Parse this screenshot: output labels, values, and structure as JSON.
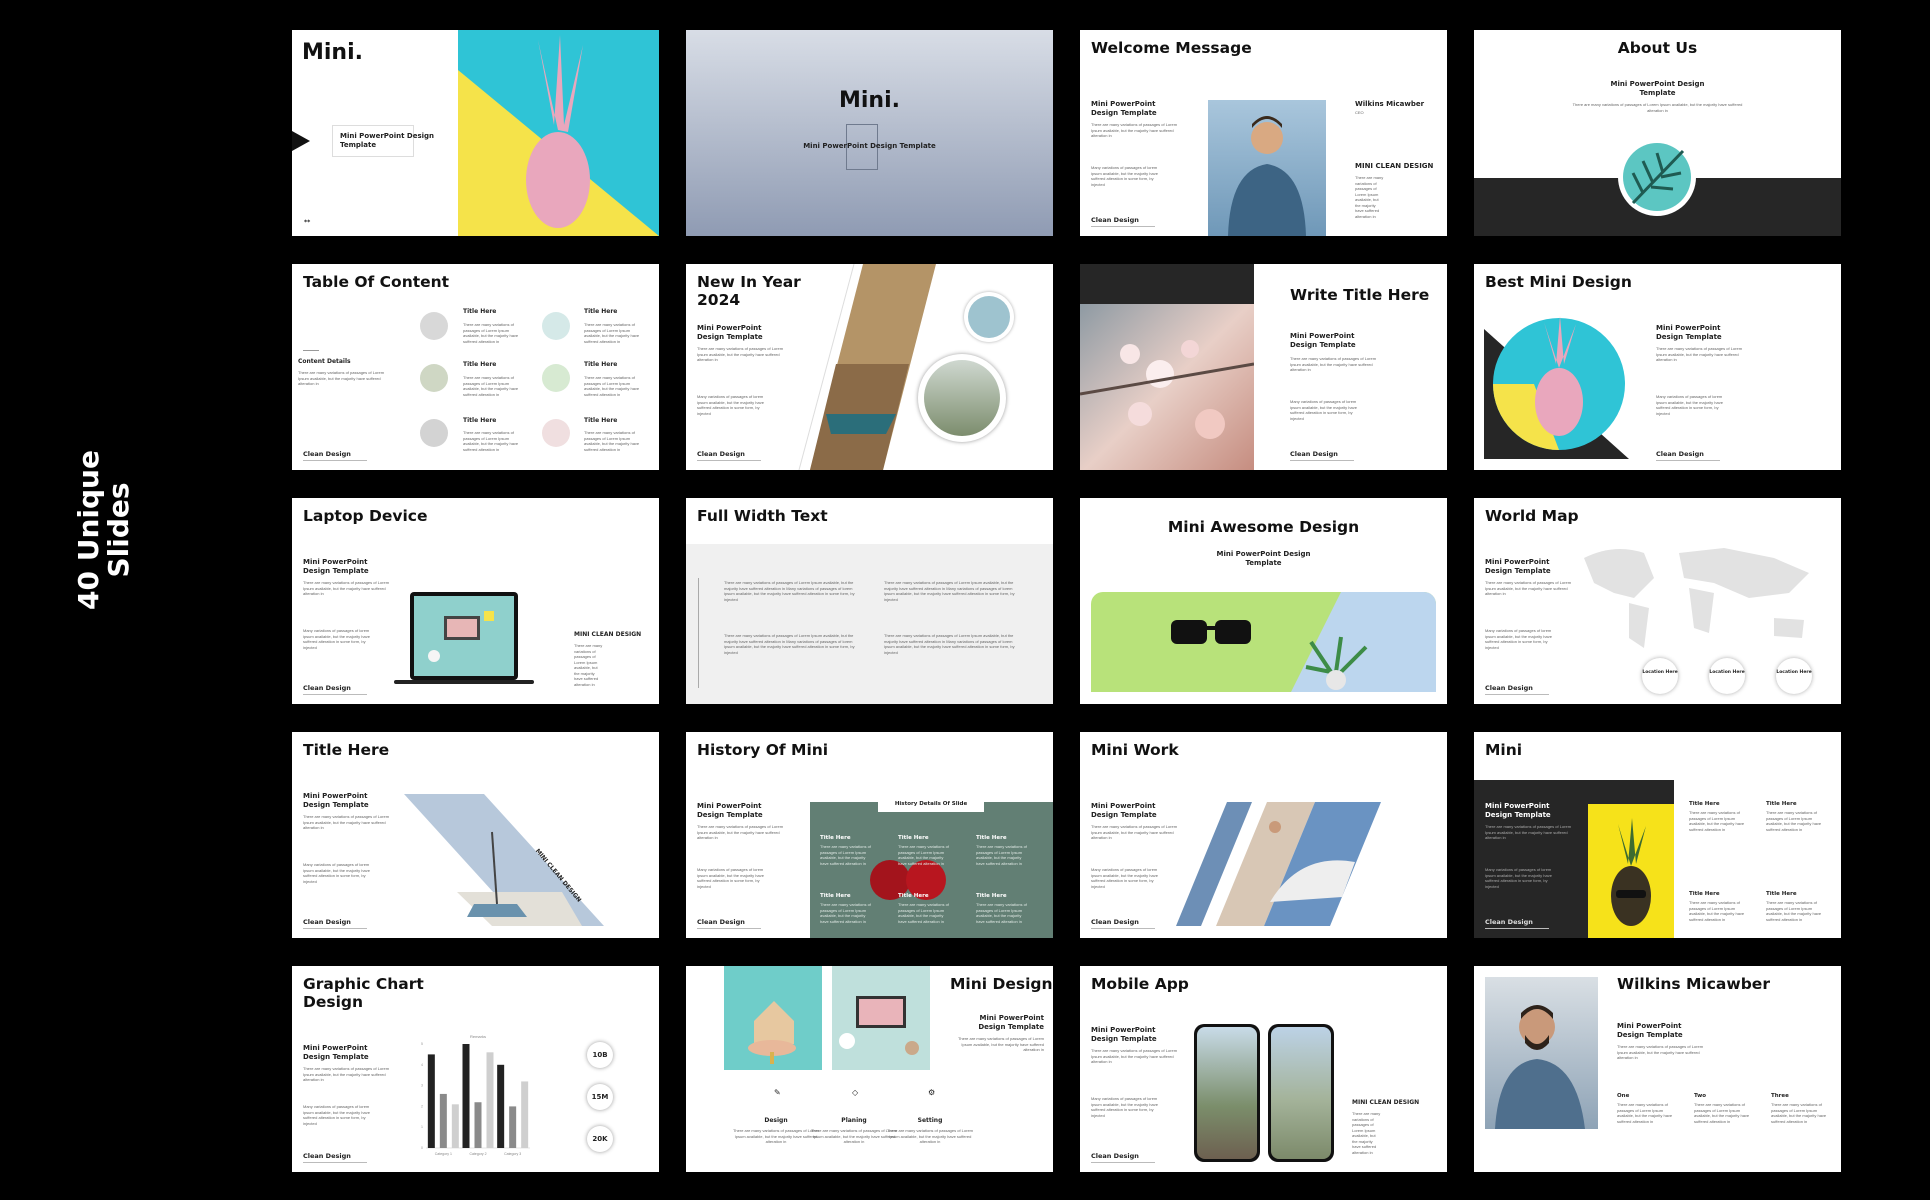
{
  "side_label": {
    "line1": "40 Unique",
    "line2": "Slides"
  },
  "common": {
    "template": "Mini PowerPoint Design Template",
    "template_l1": "Mini PowerPoint Design",
    "template_l2": "Template",
    "footer": "Clean Design",
    "title_here": "Title Here",
    "mini_clean_design": "MINI CLEAN DESIGN",
    "mini_clean_design_mixed": "MINI CLEAN DESIGN",
    "para": "There are many variations of passages of Lorem Ipsum available, but the majority have suffered alteration in",
    "bullet": "Many variations of passages of lorem ipsum available, but the majority have suffered alteration in some form, by injected"
  },
  "slides": [
    {
      "title": "Mini.",
      "box": "Mini PowerPoint Design Template",
      "corner": "**"
    },
    {
      "title": "Mini.",
      "subtitle": "Mini PowerPoint Design Template"
    },
    {
      "title": "Welcome Message",
      "name": "Wilkins Micawber",
      "role": "CEO",
      "tag": "MINI CLEAN DESIGN"
    },
    {
      "title": "About Us"
    },
    {
      "title": "Table Of Content",
      "section": "Content Details"
    },
    {
      "title_l1": "New In Year",
      "title_l2": "2024"
    },
    {
      "title": "Write Title Here"
    },
    {
      "title": "Best Mini Design"
    },
    {
      "title": "Laptop Device",
      "tag": "MINI CLEAN DESIGN"
    },
    {
      "title": "Full Width Text"
    },
    {
      "title": "Mini Awesome Design"
    },
    {
      "title": "World Map",
      "location": "Location Here"
    },
    {
      "title": "Title Here",
      "tag": "MINI CLEAN DESIGN"
    },
    {
      "title": "History Of Mini",
      "tab": "History Details Of Slide"
    },
    {
      "title": "Mini Work"
    },
    {
      "title": "Mini"
    },
    {
      "title_l1": "Graphic Chart",
      "title_l2": "Design",
      "chart_title": "Remarks",
      "stats": [
        "10B",
        "15M",
        "20K"
      ]
    },
    {
      "title": "Mini Design",
      "features": [
        "Design",
        "Planing",
        "Setting"
      ]
    },
    {
      "title": "Mobile App",
      "tag": "MINI CLEAN DESIGN"
    },
    {
      "title": "Wilkins Micawber",
      "columns": [
        "One",
        "Two",
        "Three"
      ]
    }
  ],
  "chart_data": {
    "type": "bar",
    "title": "Remarks",
    "categories": [
      "Category 1",
      "Category 2",
      "Category 3"
    ],
    "series": [
      {
        "values": [
          4.5,
          5.0,
          4.0
        ],
        "color": "#222222"
      },
      {
        "values": [
          2.6,
          2.2,
          2.0
        ],
        "color": "#8a8a8a"
      },
      {
        "values": [
          2.1,
          4.6,
          3.2
        ],
        "color": "#cfcfcf"
      }
    ],
    "ylim": [
      0,
      5
    ]
  },
  "colors": {
    "background": "#000000",
    "slide": "#ffffff",
    "dark": "#262626",
    "accent_cyan": "#2fc4d6",
    "accent_yellow": "#f5e34a",
    "accent_pink": "#e9a7bd"
  }
}
